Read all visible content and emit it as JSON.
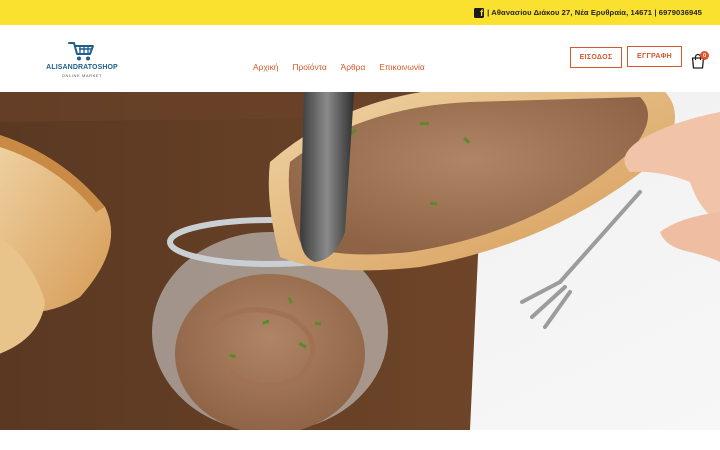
{
  "topbar": {
    "icon": "facebook-icon",
    "info": "| Αθανασίου Διάκου 27, Νέα Ερυθραία, 14671 | 6979036945",
    "background": "#fbe12f"
  },
  "logo": {
    "name": "ALISANDRATOSHOP",
    "tagline": "ONLINE MARKET",
    "icon": "shopping-cart-icon"
  },
  "nav": [
    {
      "label": "Αρχική"
    },
    {
      "label": "Προϊόντα"
    },
    {
      "label": "Άρθρα"
    },
    {
      "label": "Επικοινωνία"
    }
  ],
  "auth": {
    "login": "ΕΙΣΟΔΟΣ",
    "register": "ΕΓΓΡΑΦΗ"
  },
  "cart": {
    "icon": "shopping-bag-icon",
    "count": "0"
  },
  "colors": {
    "accent": "#d5582b",
    "brand": "#1f5f8b",
    "topbar": "#fbe12f"
  }
}
